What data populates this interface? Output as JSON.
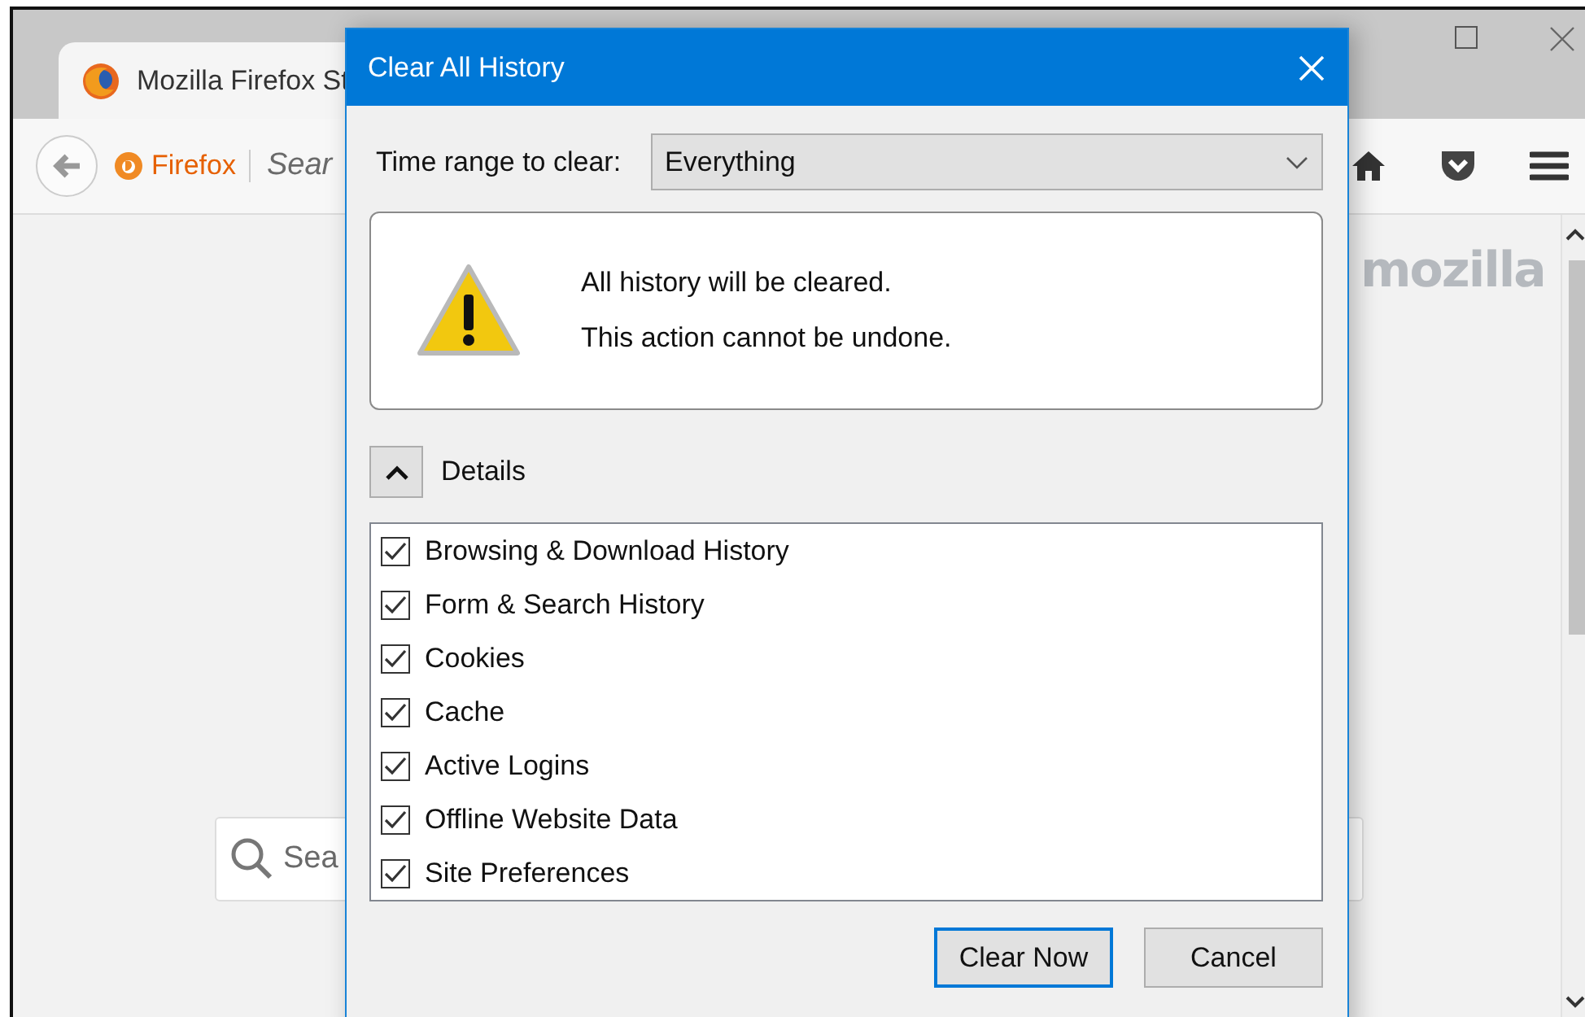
{
  "browser": {
    "tab": {
      "title": "Mozilla Firefox St"
    },
    "url_bar": {
      "identity": "Firefox",
      "placeholder": "Sear"
    },
    "page": {
      "logo": "mozilla",
      "search": {
        "placeholder": "Sea"
      }
    }
  },
  "dialog": {
    "title": "Clear All History",
    "time_range": {
      "label": "Time range to clear:",
      "value": "Everything"
    },
    "warning": [
      "All history will be cleared.",
      "This action cannot be undone."
    ],
    "details": {
      "label": "Details",
      "expanded": true
    },
    "items": [
      {
        "label": "Browsing & Download History",
        "checked": true
      },
      {
        "label": "Form & Search History",
        "checked": true
      },
      {
        "label": "Cookies",
        "checked": true
      },
      {
        "label": "Cache",
        "checked": true
      },
      {
        "label": "Active Logins",
        "checked": true
      },
      {
        "label": "Offline Website Data",
        "checked": true
      },
      {
        "label": "Site Preferences",
        "checked": true
      }
    ],
    "buttons": [
      {
        "label": "Clear Now",
        "default": true
      },
      {
        "label": "Cancel",
        "default": false
      }
    ]
  }
}
